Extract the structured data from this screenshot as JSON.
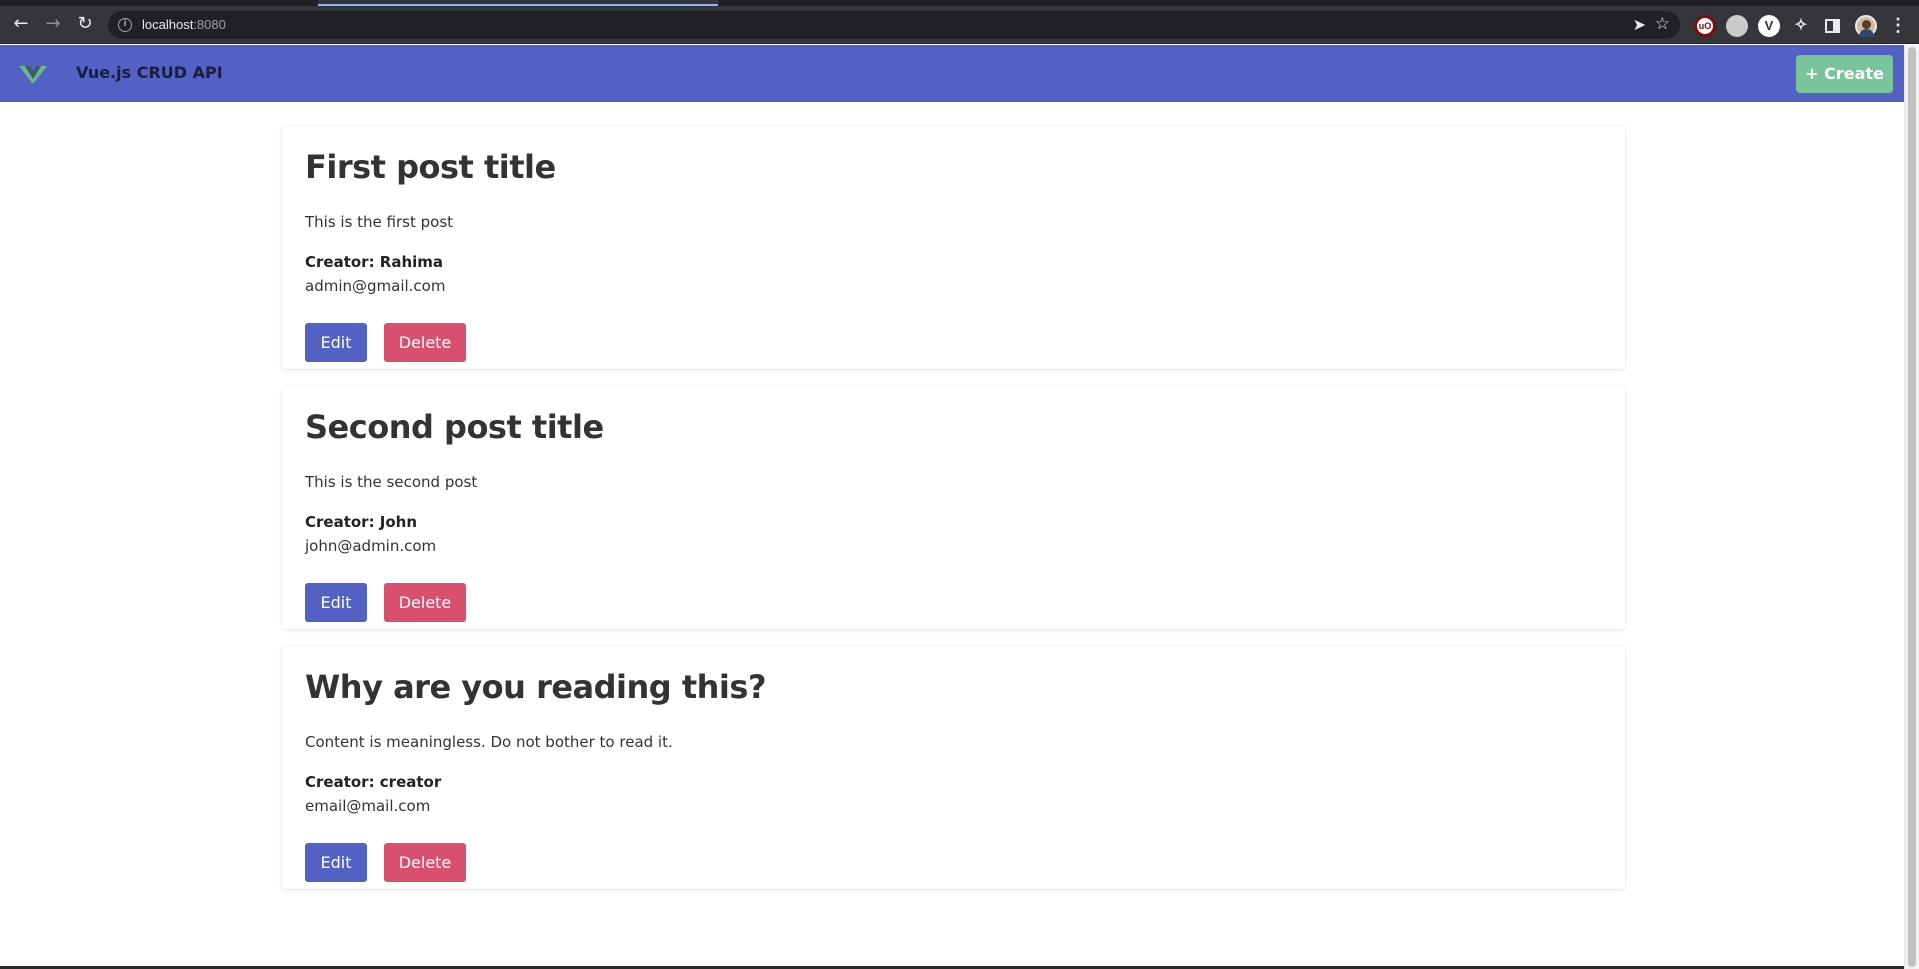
{
  "browser": {
    "url_host": "localhost",
    "url_port": ":8080",
    "back_icon": "arrow-left",
    "forward_icon": "arrow-right",
    "reload_icon": "reload",
    "extensions": [
      "ublock-origin-icon",
      "grey-extension-icon",
      "vue-devtools-icon",
      "extensions-puzzle-icon",
      "side-panel-icon",
      "profile-avatar",
      "menu-kebab-icon"
    ]
  },
  "navbar": {
    "brand": "Vue.js CRUD API",
    "create_label": "+ Create",
    "colors": {
      "navbar": "#5360c4",
      "create_button": "#79c49b",
      "vue_logo": "#6fb58e"
    }
  },
  "posts": [
    {
      "title": "First post title",
      "body": "This is the first post",
      "creator": "Creator: Rahima",
      "email": "admin@gmail.com",
      "edit_label": "Edit",
      "delete_label": "Delete"
    },
    {
      "title": "Second post title",
      "body": "This is the second post",
      "creator": "Creator: John",
      "email": "john@admin.com",
      "edit_label": "Edit",
      "delete_label": "Delete"
    },
    {
      "title": "Why are you reading this?",
      "body": "Content is meaningless. Do not bother to read it.",
      "creator": "Creator: creator",
      "email": "email@mail.com",
      "edit_label": "Edit",
      "delete_label": "Delete"
    }
  ],
  "colors": {
    "edit_button": "#5360c4",
    "delete_button": "#d9506e"
  }
}
